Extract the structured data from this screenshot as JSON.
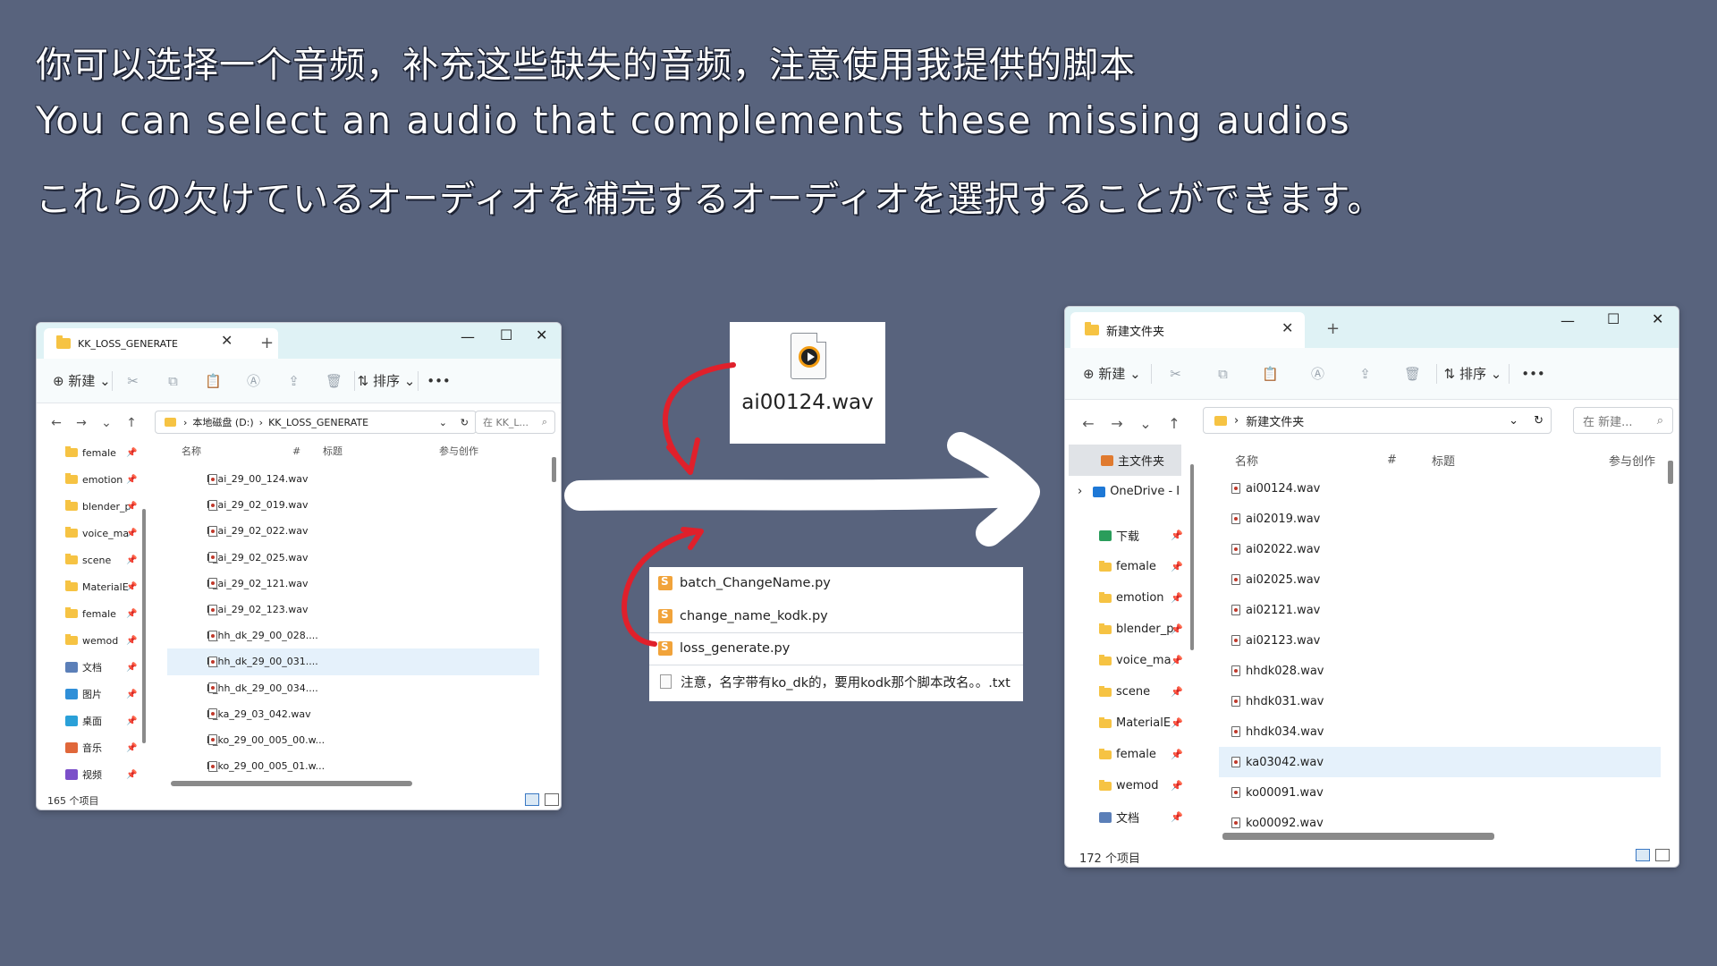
{
  "headlines": {
    "zh": "你可以选择一个音频，补充这些缺失的音频，注意使用我提供的脚本",
    "en": "You can select an audio that complements these missing audios",
    "ja": "これらの欠けているオーディオを補完するオーディオを選択することができます。"
  },
  "left_window": {
    "tab_title": "KK_LOSS_GENERATE",
    "toolbar": {
      "new_label": "新建",
      "sort_label": "排序",
      "more": "•••"
    },
    "breadcrumb": [
      "本地磁盘 (D:)",
      "KK_LOSS_GENERATE"
    ],
    "search_placeholder": "在 KK_L...",
    "sidebar": [
      {
        "label": "female",
        "icon": "folder-icon"
      },
      {
        "label": "emotion",
        "icon": "folder-icon"
      },
      {
        "label": "blender_p",
        "icon": "folder-icon"
      },
      {
        "label": "voice_ma",
        "icon": "folder-icon"
      },
      {
        "label": "scene",
        "icon": "folder-icon"
      },
      {
        "label": "MaterialE",
        "icon": "folder-icon"
      },
      {
        "label": "female",
        "icon": "folder-icon"
      },
      {
        "label": "wemod",
        "icon": "folder-icon"
      },
      {
        "label": "文档",
        "icon": "documents-icon"
      },
      {
        "label": "图片",
        "icon": "pictures-icon"
      },
      {
        "label": "桌面",
        "icon": "desktop-icon"
      },
      {
        "label": "音乐",
        "icon": "music-icon"
      },
      {
        "label": "视频",
        "icon": "videos-icon"
      }
    ],
    "columns": [
      "名称",
      "#",
      "标题",
      "参与创作"
    ],
    "files": [
      "h_ai_29_00_124.wav",
      "h_ai_29_02_019.wav",
      "h_ai_29_02_022.wav",
      "h_ai_29_02_025.wav",
      "h_ai_29_02_121.wav",
      "h_ai_29_02_123.wav",
      "h_hh_dk_29_00_028....",
      "h_hh_dk_29_00_031....",
      "h_hh_dk_29_00_034....",
      "h_ka_29_03_042.wav",
      "h_ko_29_00_005_00.w...",
      "h_ko_29_00_005_01.w..."
    ],
    "selected_index": 7,
    "status": "165 个项目"
  },
  "audio_card": {
    "name": "ai00124.wav"
  },
  "scripts": [
    {
      "name": "batch_ChangeName.py",
      "icon": "python-icon"
    },
    {
      "name": "change_name_kodk.py",
      "icon": "python-icon"
    },
    {
      "name": "loss_generate.py",
      "icon": "python-icon"
    },
    {
      "name": "注意，名字带有ko_dk的，要用kodk那个脚本改名。。.txt",
      "icon": "text-file-icon"
    }
  ],
  "right_window": {
    "tab_title": "新建文件夹",
    "toolbar": {
      "new_label": "新建",
      "sort_label": "排序",
      "more": "•••"
    },
    "breadcrumb": [
      "新建文件夹"
    ],
    "search_placeholder": "在 新建...",
    "sidebar_top": [
      {
        "label": "主文件夹",
        "icon": "home-icon"
      },
      {
        "label": "OneDrive - I",
        "icon": "onedrive-icon"
      }
    ],
    "sidebar": [
      {
        "label": "下载",
        "icon": "download-icon"
      },
      {
        "label": "female",
        "icon": "folder-icon"
      },
      {
        "label": "emotion",
        "icon": "folder-icon"
      },
      {
        "label": "blender_p",
        "icon": "folder-icon"
      },
      {
        "label": "voice_ma",
        "icon": "folder-icon"
      },
      {
        "label": "scene",
        "icon": "folder-icon"
      },
      {
        "label": "MaterialE",
        "icon": "folder-icon"
      },
      {
        "label": "female",
        "icon": "folder-icon"
      },
      {
        "label": "wemod",
        "icon": "folder-icon"
      },
      {
        "label": "文档",
        "icon": "documents-icon"
      }
    ],
    "columns": [
      "名称",
      "#",
      "标题",
      "参与创作"
    ],
    "files": [
      "ai00124.wav",
      "ai02019.wav",
      "ai02022.wav",
      "ai02025.wav",
      "ai02121.wav",
      "ai02123.wav",
      "hhdk028.wav",
      "hhdk031.wav",
      "hhdk034.wav",
      "ka03042.wav",
      "ko00091.wav",
      "ko00092.wav"
    ],
    "selected_index": 9,
    "status": "172 个项目"
  },
  "colors": {
    "background": "#58637d",
    "titlebar": "#dff2f5",
    "arrow_red": "#e0202b",
    "arrow_white": "#ffffff",
    "selection": "#e5f1fb"
  }
}
